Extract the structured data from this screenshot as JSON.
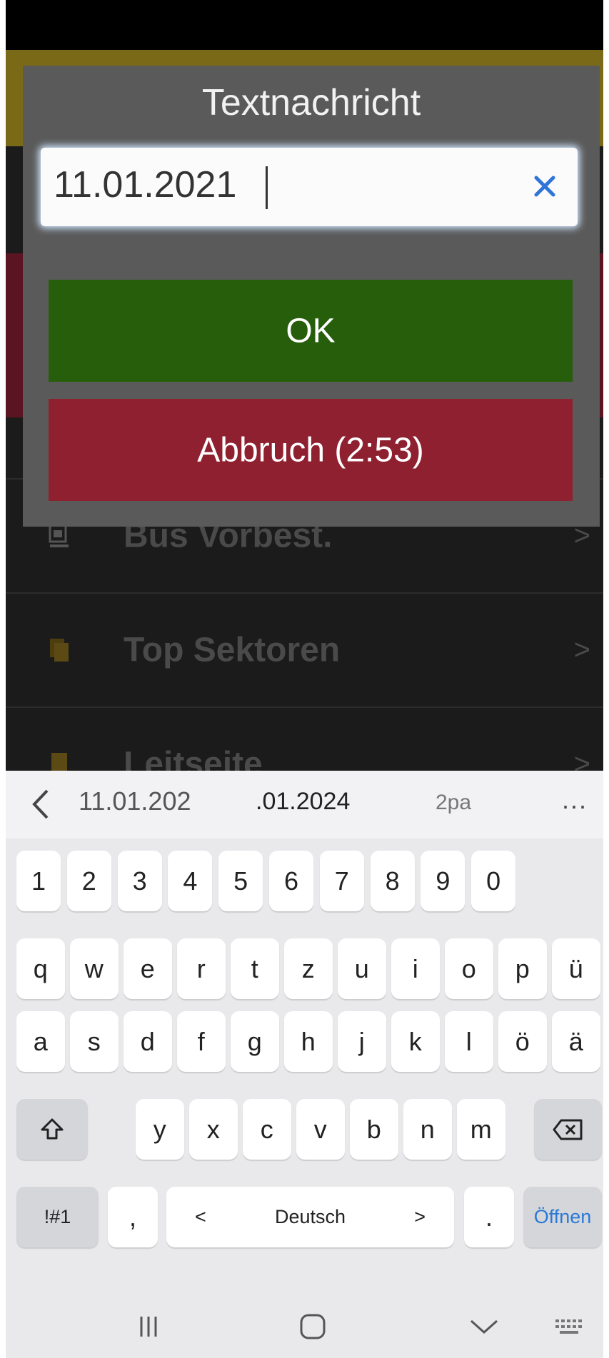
{
  "app": {
    "rows": [
      {
        "label": "Bus Vorbest.",
        "arrow": ">"
      },
      {
        "label": "Top Sektoren",
        "arrow": ">"
      },
      {
        "label": "Leitseite",
        "arrow": ">"
      }
    ],
    "colors": {
      "yellow": "#7a6a18",
      "red": "#5b1522",
      "icon_yellow": "#5c4a14"
    }
  },
  "dialog": {
    "title": "Textnachricht",
    "input_value": "11.01.2021",
    "clear_icon": "close-icon",
    "ok_label": "OK",
    "cancel_label": "Abbruch (2:53)",
    "colors": {
      "ok": "#275e0c",
      "cancel": "#8f2030",
      "clear": "#2f74d6"
    }
  },
  "keyboard": {
    "suggestions": [
      "11.01.202",
      ".01.2024",
      "2pa"
    ],
    "more_label": "...",
    "number_row": [
      "1",
      "2",
      "3",
      "4",
      "5",
      "6",
      "7",
      "8",
      "9",
      "0"
    ],
    "row1": [
      "q",
      "w",
      "e",
      "r",
      "t",
      "z",
      "u",
      "i",
      "o",
      "p",
      "ü"
    ],
    "row2": [
      "a",
      "s",
      "d",
      "f",
      "g",
      "h",
      "j",
      "k",
      "l",
      "ö",
      "ä"
    ],
    "row3": [
      "y",
      "x",
      "c",
      "v",
      "b",
      "n",
      "m"
    ],
    "symbols_label": "!#1",
    "comma_label": ",",
    "space_left": "<",
    "space_label": "Deutsch",
    "space_right": ">",
    "period_label": ".",
    "action_label": "Öffnen",
    "action_color": "#2a79d6"
  },
  "navbar": {
    "items": [
      "recent-apps-icon",
      "home-icon",
      "back-icon",
      "keyboard-icon"
    ]
  }
}
